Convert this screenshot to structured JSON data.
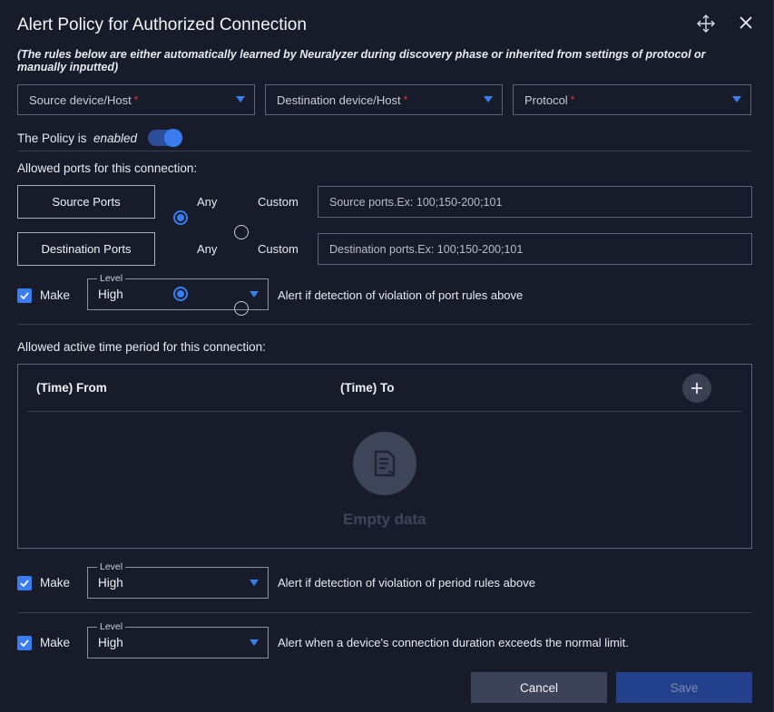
{
  "dialog": {
    "title": "Alert Policy for Authorized Connection",
    "subtitle": "(The rules below are either automatically learned by Neuralyzer during discovery phase or inherited from settings of protocol or manually inputted)"
  },
  "selects": {
    "source": "Source device/Host",
    "destination": "Destination device/Host",
    "protocol": "Protocol",
    "required_mark": "*"
  },
  "policy": {
    "label": "The Policy is",
    "state": "enabled",
    "enabled": true
  },
  "ports": {
    "heading": "Allowed ports for this connection:",
    "source_label": "Source Ports",
    "destination_label": "Destination Ports",
    "any_label": "Any",
    "custom_label": "Custom",
    "source_placeholder": "Source ports.Ex: 100;150-200;101",
    "destination_placeholder": "Destination ports.Ex: 100;150-200;101"
  },
  "alerts": {
    "make_label": "Make",
    "level_tag": "Level",
    "port_rule": {
      "level": "High",
      "text": "Alert if detection of violation of port rules above"
    },
    "period_rule": {
      "level": "High",
      "text": "Alert if detection of violation of period rules above"
    },
    "duration_rule": {
      "level": "High",
      "text": "Alert when a device's connection duration exceeds the normal limit."
    }
  },
  "time": {
    "heading": "Allowed active time period for this connection:",
    "col_from": "(Time) From",
    "col_to": "(Time) To",
    "empty_text": "Empty data"
  },
  "footer": {
    "cancel": "Cancel",
    "save": "Save"
  },
  "colors": {
    "accent": "#3a7df0",
    "required": "#e0343c",
    "background": "#181c2a"
  }
}
